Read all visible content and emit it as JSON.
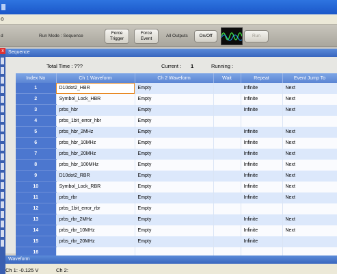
{
  "menubar": {
    "fragment": "o"
  },
  "toolbar": {
    "left_fragment": "d",
    "run_mode": "Run Mode : Sequence",
    "force_trigger": "Force Trigger",
    "force_event": "Force Event",
    "all_outputs": "All Outputs",
    "on_off": "On/Off",
    "run": "Run"
  },
  "left_strip": {
    "close": "x"
  },
  "sequence": {
    "title": "Sequence",
    "total_time_label": "Total Time : ???",
    "current_label": "Current :",
    "current_value": "1",
    "running_label": "Running :",
    "columns": [
      "Index No",
      "Ch 1 Waveform",
      "Ch 2 Waveform",
      "Wait",
      "Repeat",
      "Event Jump To"
    ],
    "rows": [
      {
        "idx": "1",
        "ch1": "D10dot2_HBR",
        "ch2": "Empty",
        "wait": "",
        "repeat": "Infinite",
        "jump": "Next"
      },
      {
        "idx": "2",
        "ch1": "Symbol_Lock_HBR",
        "ch2": "Empty",
        "wait": "",
        "repeat": "Infinite",
        "jump": "Next"
      },
      {
        "idx": "3",
        "ch1": "prbs_hbr",
        "ch2": "Empty",
        "wait": "",
        "repeat": "Infinite",
        "jump": "Next"
      },
      {
        "idx": "4",
        "ch1": "prbs_1bit_error_hbr",
        "ch2": "Empty",
        "wait": "",
        "repeat": "",
        "jump": ""
      },
      {
        "idx": "5",
        "ch1": "prbs_hbr_2MHz",
        "ch2": "Empty",
        "wait": "",
        "repeat": "Infinite",
        "jump": "Next"
      },
      {
        "idx": "6",
        "ch1": "prbs_hbr_10MHz",
        "ch2": "Empty",
        "wait": "",
        "repeat": "Infinite",
        "jump": "Next"
      },
      {
        "idx": "7",
        "ch1": "prbs_hbr_20MHz",
        "ch2": "Empty",
        "wait": "",
        "repeat": "Infinite",
        "jump": "Next"
      },
      {
        "idx": "8",
        "ch1": "prbs_hbr_100MHz",
        "ch2": "Empty",
        "wait": "",
        "repeat": "Infinite",
        "jump": "Next"
      },
      {
        "idx": "9",
        "ch1": "D10dot2_RBR",
        "ch2": "Empty",
        "wait": "",
        "repeat": "Infinite",
        "jump": "Next"
      },
      {
        "idx": "10",
        "ch1": "Symbol_Lock_RBR",
        "ch2": "Empty",
        "wait": "",
        "repeat": "Infinite",
        "jump": "Next"
      },
      {
        "idx": "11",
        "ch1": "prbs_rbr",
        "ch2": "Empty",
        "wait": "",
        "repeat": "Infinite",
        "jump": "Next"
      },
      {
        "idx": "12",
        "ch1": "prbs_1bit_error_rbr",
        "ch2": "Empty",
        "wait": "",
        "repeat": "",
        "jump": ""
      },
      {
        "idx": "13",
        "ch1": "prbs_rbr_2MHz",
        "ch2": "Empty",
        "wait": "",
        "repeat": "Infinite",
        "jump": "Next"
      },
      {
        "idx": "14",
        "ch1": "prbs_rbr_10MHz",
        "ch2": "Empty",
        "wait": "",
        "repeat": "Infinite",
        "jump": "Next"
      },
      {
        "idx": "15",
        "ch1": "prbs_rbr_20MHz",
        "ch2": "Empty",
        "wait": "",
        "repeat": "Infinite",
        "jump": ""
      },
      {
        "idx": "16",
        "ch1": "",
        "ch2": "",
        "wait": "",
        "repeat": "",
        "jump": ""
      }
    ]
  },
  "waveform": {
    "title": "Waveform",
    "ch1": "Ch 1: -0.125 V",
    "ch2": "Ch 2:"
  }
}
